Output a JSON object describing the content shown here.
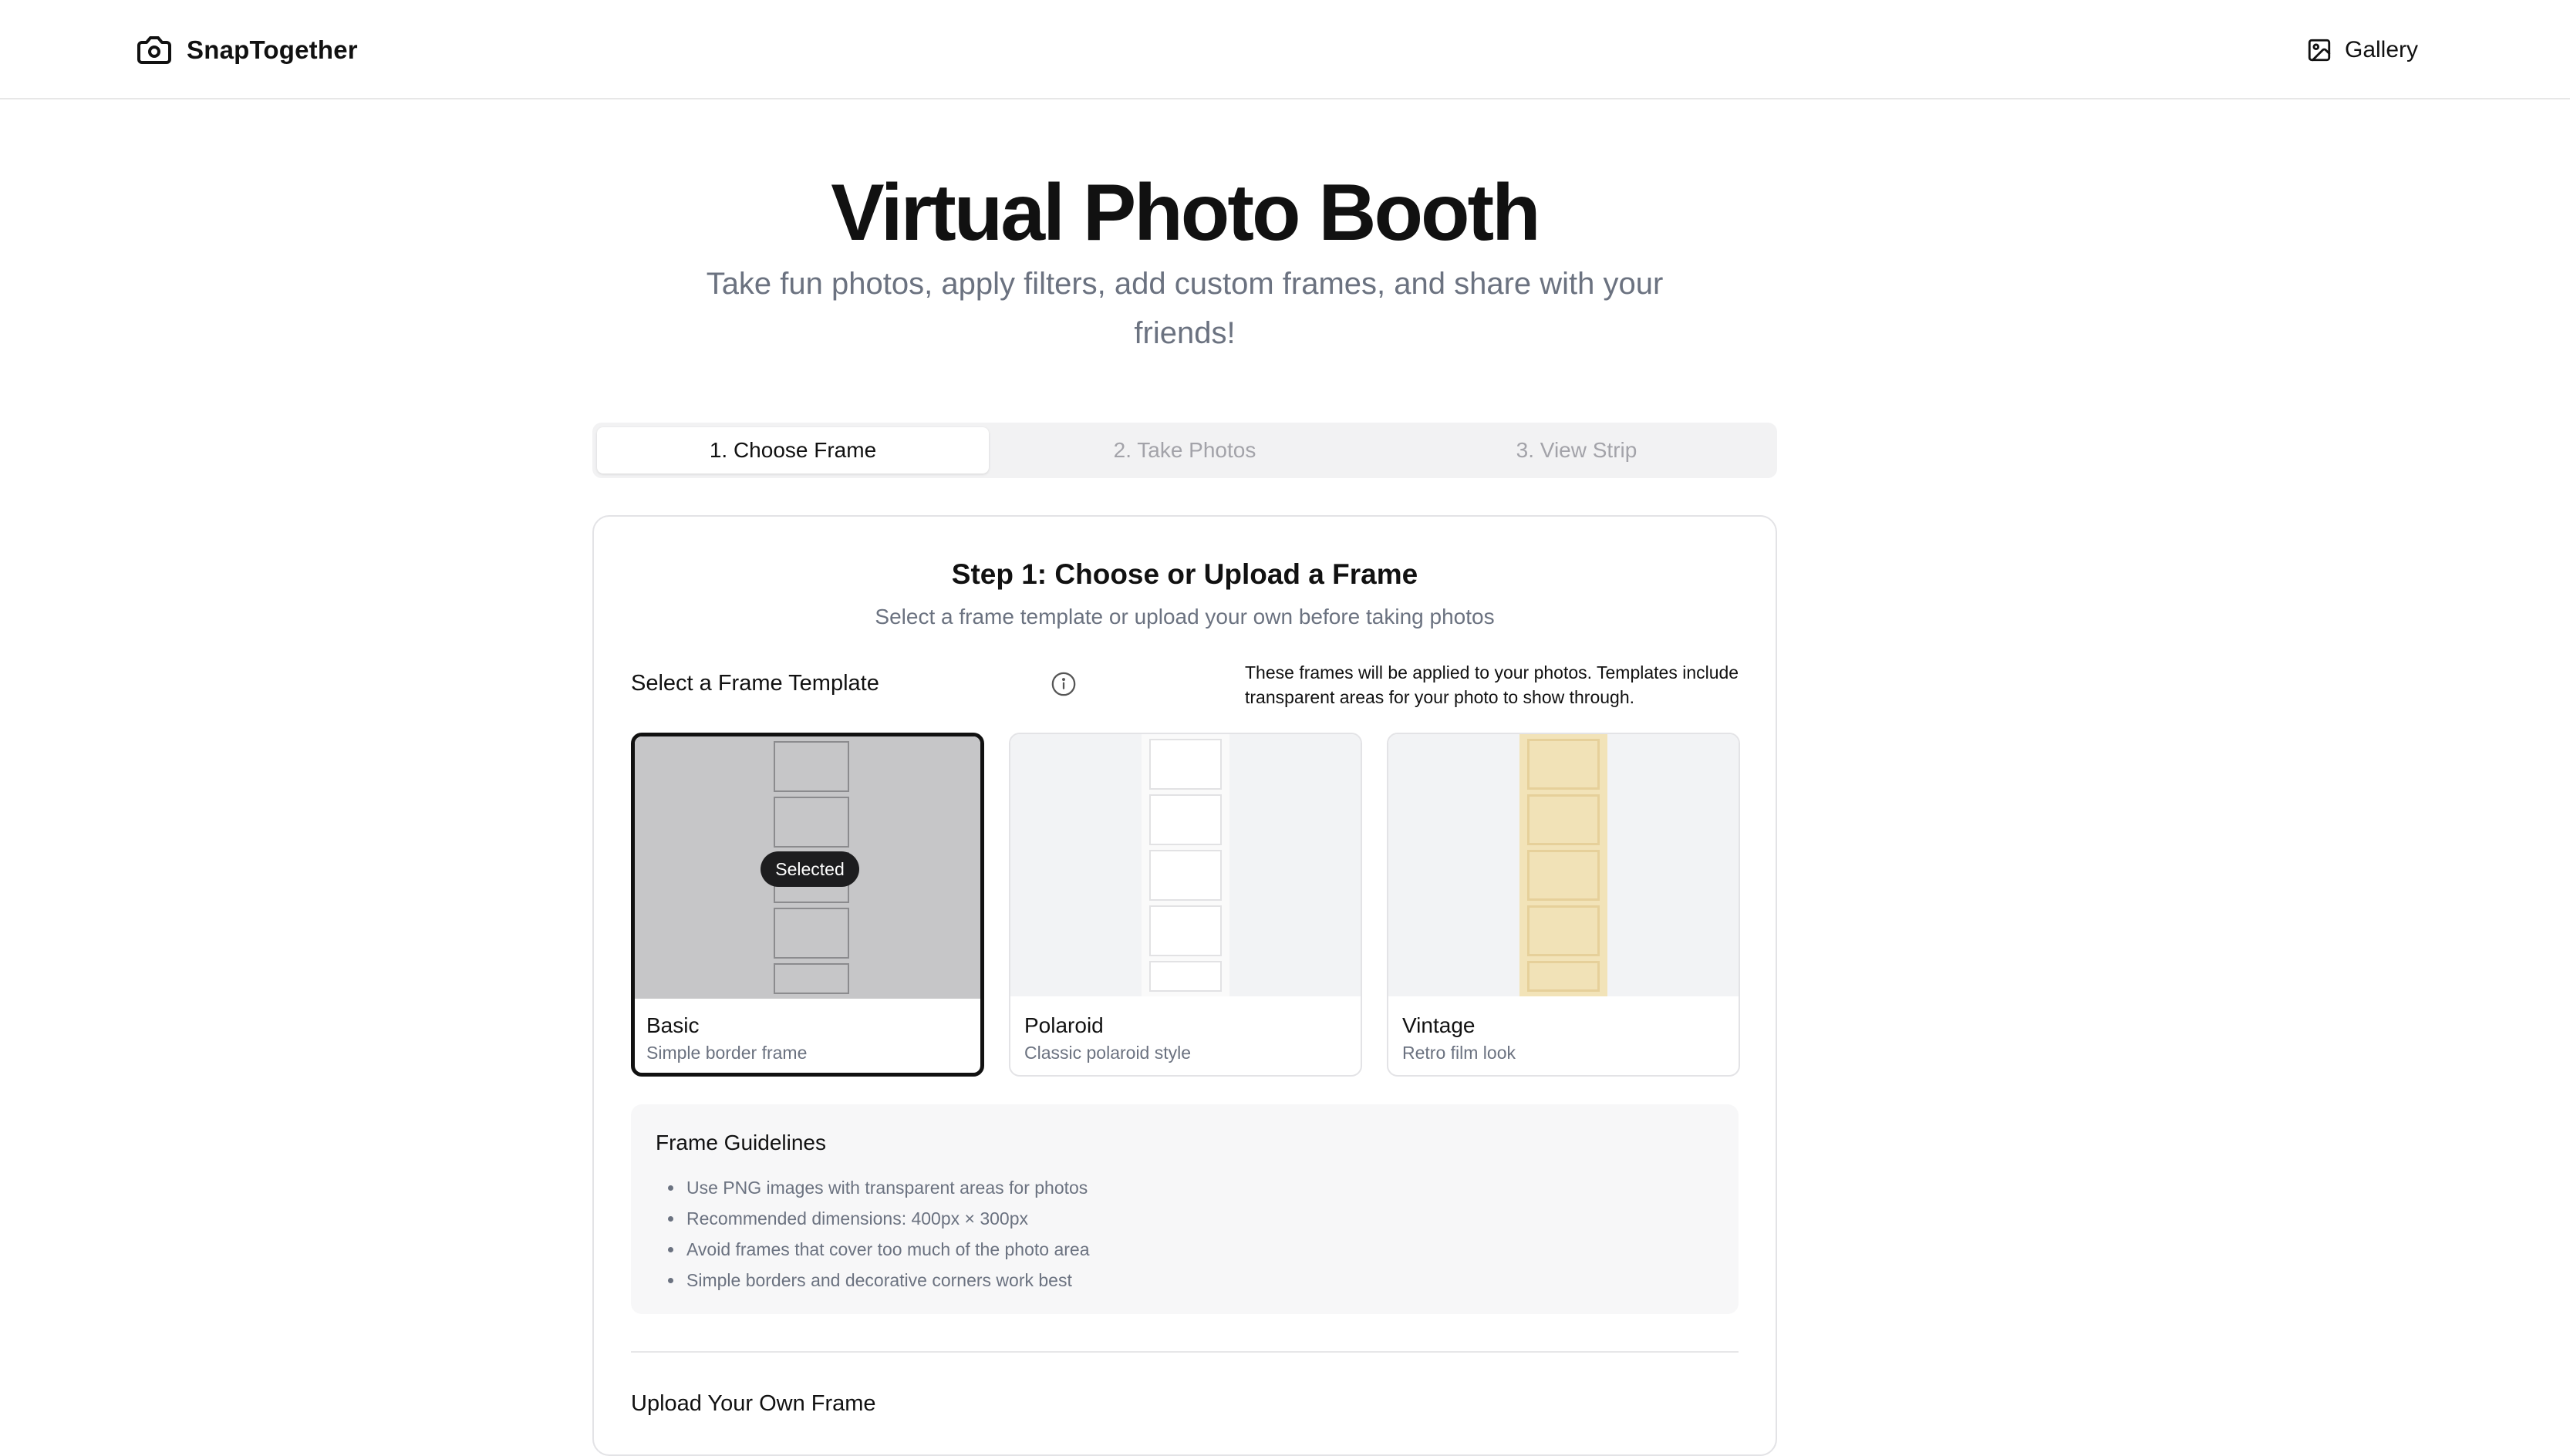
{
  "header": {
    "brand_name": "SnapTogether",
    "brand_icon": "camera-icon",
    "gallery_label": "Gallery",
    "gallery_icon": "image-icon"
  },
  "hero": {
    "title": "Virtual Photo Booth",
    "subtitle": "Take fun photos, apply filters, add custom frames, and share with your friends!"
  },
  "tabs": [
    {
      "label": "1. Choose Frame",
      "active": true
    },
    {
      "label": "2. Take Photos",
      "active": false
    },
    {
      "label": "3. View Strip",
      "active": false
    }
  ],
  "step": {
    "title": "Step 1: Choose or Upload a Frame",
    "subtitle": "Select a frame template or upload your own before taking photos",
    "select_label": "Select a Frame Template",
    "info_icon": "info-icon",
    "info_text": "These frames will be applied to your photos. Templates include transparent areas for your photo to show through."
  },
  "frames": [
    {
      "name": "Basic",
      "desc": "Simple border frame",
      "selected": true,
      "badge": "Selected"
    },
    {
      "name": "Polaroid",
      "desc": "Classic polaroid style",
      "selected": false
    },
    {
      "name": "Vintage",
      "desc": "Retro film look",
      "selected": false
    }
  ],
  "guidelines": {
    "title": "Frame Guidelines",
    "items": [
      "Use PNG images with transparent areas for photos",
      "Recommended dimensions: 400px × 300px",
      "Avoid frames that cover too much of the photo area",
      "Simple borders and decorative corners work best"
    ]
  },
  "upload": {
    "title": "Upload Your Own Frame"
  },
  "colors": {
    "accent": "#111111",
    "muted_text": "#6b7280",
    "vintage": "#f2e3b8"
  }
}
